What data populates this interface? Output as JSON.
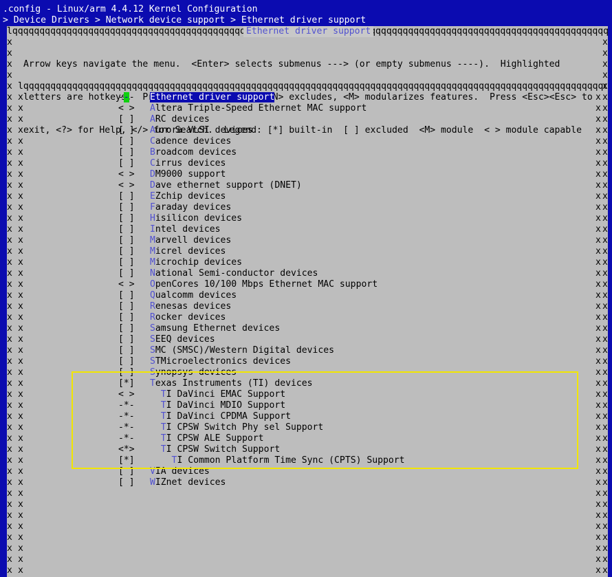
{
  "window": {
    "title": ".config - Linux/arm 4.4.12 Kernel Configuration",
    "breadcrumb": "> Device Drivers > Network device support > Ethernet driver support "
  },
  "dialog": {
    "title": "Ethernet driver support",
    "help_lines": [
      "Arrow keys navigate the menu.  <Enter> selects submenus ---> (or empty submenus ----).  Highlighted",
      "letters are hotkeys.  Pressing <Y> includes, <N> excludes, <M> modularizes features.  Press <Esc><Esc> to",
      "exit, <?> for Help, </> for Search.  Legend: [*] built-in  [ ] excluded  <M> module  < > module capable"
    ]
  },
  "menu": {
    "items": [
      {
        "prefix": "--- ",
        "hotkey": "",
        "rest": "Ethernet driver support",
        "indent": 0,
        "selected": true
      },
      {
        "prefix": "< > ",
        "hotkey": "A",
        "rest": "ltera Triple-Speed Ethernet MAC support",
        "indent": 0
      },
      {
        "prefix": "[ ] ",
        "hotkey": "A",
        "rest": "RC devices",
        "indent": 0
      },
      {
        "prefix": "[ ] ",
        "hotkey": "A",
        "rest": "urora VLSI devices",
        "indent": 0
      },
      {
        "prefix": "[ ] ",
        "hotkey": "C",
        "rest": "adence devices",
        "indent": 0
      },
      {
        "prefix": "[ ] ",
        "hotkey": "B",
        "rest": "roadcom devices",
        "indent": 0
      },
      {
        "prefix": "[ ] ",
        "hotkey": "C",
        "rest": "irrus devices",
        "indent": 0
      },
      {
        "prefix": "< > ",
        "hotkey": "D",
        "rest": "M9000 support",
        "indent": 0
      },
      {
        "prefix": "< > ",
        "hotkey": "D",
        "rest": "ave ethernet support (DNET)",
        "indent": 0
      },
      {
        "prefix": "[ ] ",
        "hotkey": "E",
        "rest": "Zchip devices",
        "indent": 0
      },
      {
        "prefix": "[ ] ",
        "hotkey": "F",
        "rest": "araday devices",
        "indent": 0
      },
      {
        "prefix": "[ ] ",
        "hotkey": "H",
        "rest": "isilicon devices",
        "indent": 0
      },
      {
        "prefix": "[ ] ",
        "hotkey": "I",
        "rest": "ntel devices",
        "indent": 0
      },
      {
        "prefix": "[ ] ",
        "hotkey": "M",
        "rest": "arvell devices",
        "indent": 0
      },
      {
        "prefix": "[ ] ",
        "hotkey": "M",
        "rest": "icrel devices",
        "indent": 0
      },
      {
        "prefix": "[ ] ",
        "hotkey": "M",
        "rest": "icrochip devices",
        "indent": 0
      },
      {
        "prefix": "[ ] ",
        "hotkey": "N",
        "rest": "ational Semi-conductor devices",
        "indent": 0
      },
      {
        "prefix": "< > ",
        "hotkey": "O",
        "rest": "penCores 10/100 Mbps Ethernet MAC support",
        "indent": 0
      },
      {
        "prefix": "[ ] ",
        "hotkey": "Q",
        "rest": "ualcomm devices",
        "indent": 0
      },
      {
        "prefix": "[ ] ",
        "hotkey": "R",
        "rest": "enesas devices",
        "indent": 0
      },
      {
        "prefix": "[ ] ",
        "hotkey": "R",
        "rest": "ocker devices",
        "indent": 0
      },
      {
        "prefix": "[ ] ",
        "hotkey": "S",
        "rest": "amsung Ethernet devices",
        "indent": 0
      },
      {
        "prefix": "[ ] ",
        "hotkey": "S",
        "rest": "EEQ devices",
        "indent": 0
      },
      {
        "prefix": "[ ] ",
        "hotkey": "S",
        "rest": "MC (SMSC)/Western Digital devices",
        "indent": 0
      },
      {
        "prefix": "[ ] ",
        "hotkey": "S",
        "rest": "TMicroelectronics devices",
        "indent": 0
      },
      {
        "prefix": "[ ] ",
        "hotkey": "S",
        "rest": "ynopsys devices",
        "indent": 0
      },
      {
        "prefix": "[*] ",
        "hotkey": "T",
        "rest": "exas Instruments (TI) devices",
        "indent": 0
      },
      {
        "prefix": "< > ",
        "hotkey": "T",
        "rest": "I DaVinci EMAC Support",
        "indent": 1
      },
      {
        "prefix": "-*- ",
        "hotkey": "T",
        "rest": "I DaVinci MDIO Support",
        "indent": 1
      },
      {
        "prefix": "-*- ",
        "hotkey": "T",
        "rest": "I DaVinci CPDMA Support",
        "indent": 1
      },
      {
        "prefix": "-*- ",
        "hotkey": "T",
        "rest": "I CPSW Switch Phy sel Support",
        "indent": 1
      },
      {
        "prefix": "-*- ",
        "hotkey": "T",
        "rest": "I CPSW ALE Support",
        "indent": 1
      },
      {
        "prefix": "<*> ",
        "hotkey": "T",
        "rest": "I CPSW Switch Support",
        "indent": 1
      },
      {
        "prefix": "[*] ",
        "hotkey": "T",
        "rest": "I Common Platform Time Sync (CPTS) Support",
        "indent": 2
      },
      {
        "prefix": "[ ] ",
        "hotkey": "V",
        "rest": "IA devices",
        "indent": 0
      },
      {
        "prefix": "[ ] ",
        "hotkey": "W",
        "rest": "IZnet devices",
        "indent": 0
      }
    ]
  },
  "colors": {
    "background": "#0b0bb0",
    "dialog": "#bdbdbd",
    "hotkey": "#5050d0",
    "cursor": "#10d010",
    "annotation": "#f2e600"
  }
}
